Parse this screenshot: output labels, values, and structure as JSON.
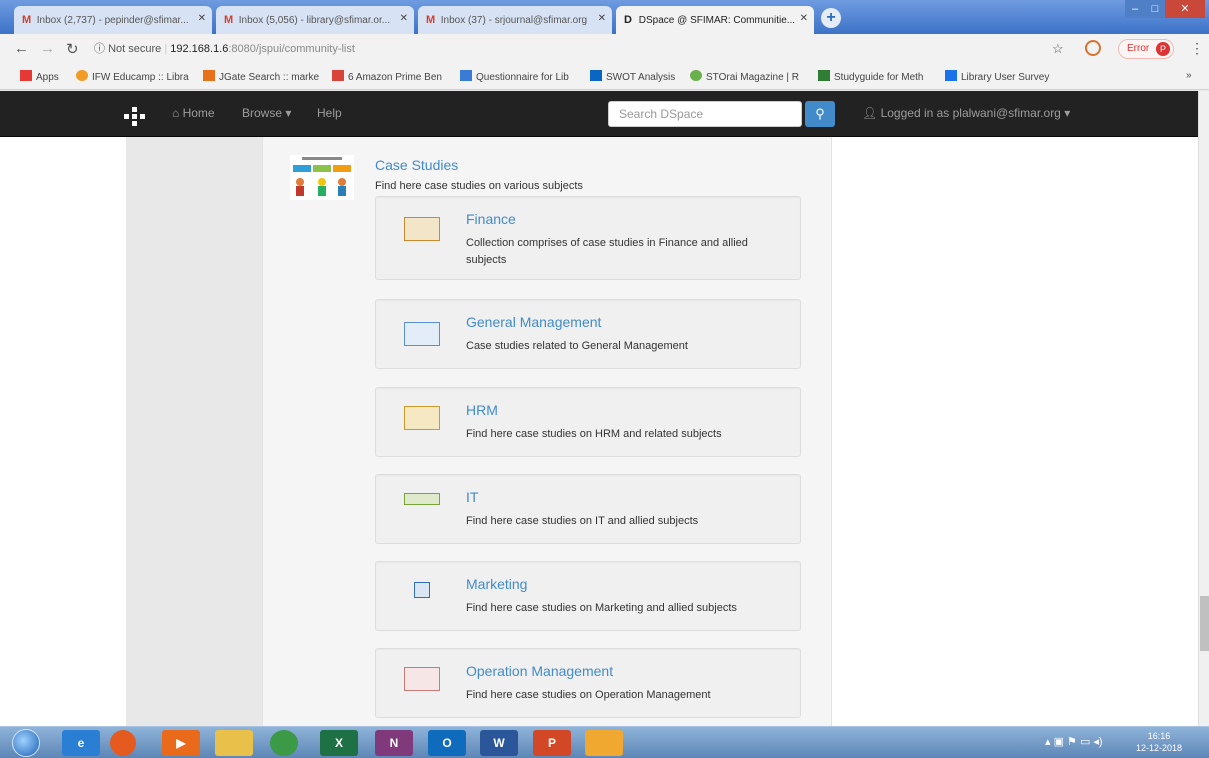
{
  "browser": {
    "tabs": [
      {
        "icon": "M",
        "label": "Inbox (2,737) - pepinder@sfimar...",
        "close": "✕"
      },
      {
        "icon": "M",
        "label": "Inbox (5,056) - library@sfimar.or...",
        "close": "✕"
      },
      {
        "icon": "M",
        "label": "Inbox (37) - srjournal@sfimar.org",
        "close": "✕"
      },
      {
        "icon": "D",
        "label": "DSpace @ SFIMAR: Communitie...",
        "close": "✕"
      }
    ],
    "new_tab": "+",
    "address": {
      "secure_label": "Not secure",
      "host": "192.168.1.6",
      "path": ":8080/jspui/community-list"
    },
    "error_label": "Error",
    "profile_initial": "P",
    "bookmarks": [
      {
        "label": "Apps",
        "color": "#e53935"
      },
      {
        "label": "IFW Educamp :: Libra",
        "color": "#f29b26"
      },
      {
        "label": "JGate Search :: marke",
        "color": "#e8711c"
      },
      {
        "label": "6 Amazon Prime Ben",
        "color": "#d9443a"
      },
      {
        "label": "Questionnaire for Lib",
        "color": "#3a7bd5"
      },
      {
        "label": "SWOT Analysis",
        "color": "#0a66c2"
      },
      {
        "label": "STOrai Magazine | R",
        "color": "#6ab04c"
      },
      {
        "label": "Studyguide for Meth",
        "color": "#2e7d32"
      },
      {
        "label": "Library User Survey",
        "color": "#1a73e8"
      }
    ],
    "bookmarks_overflow": "»"
  },
  "dspace_nav": {
    "home": "Home",
    "browse": "Browse ▾",
    "help": "Help",
    "search_placeholder": "Search DSpace",
    "logged_in": "Logged in as plalwani@sfimar.org ▾"
  },
  "parent_community": {
    "title": "Case Studies",
    "description": "Find here case studies on various subjects"
  },
  "subcommunities": [
    {
      "title": "Finance",
      "description": "Collection comprises of case studies in Finance and allied subjects",
      "thumb_color": "#c9892f"
    },
    {
      "title": "General Management",
      "description": "Case studies related to General Management",
      "thumb_color": "#5b8fd0"
    },
    {
      "title": "HRM",
      "description": "Find here case studies on HRM and related subjects",
      "thumb_color": "#c99a2a"
    },
    {
      "title": "IT",
      "description": "Find here case studies on IT and allied subjects",
      "thumb_color": "#7aa33a"
    },
    {
      "title": "Marketing",
      "description": "Find here case studies on Marketing and allied subjects",
      "thumb_color": "#2f6fb5"
    },
    {
      "title": "Operation Management",
      "description": "Find here case studies on Operation Management",
      "thumb_color": "#c97a7a"
    }
  ],
  "taskbar": {
    "apps": [
      {
        "label": "e",
        "color": "#2a7fd4"
      },
      {
        "label": "",
        "color": "#e55b1f"
      },
      {
        "label": "▶",
        "color": "#e86a1a"
      },
      {
        "label": "",
        "color": "#e9c14a"
      },
      {
        "label": "",
        "color": "#3c9a46"
      },
      {
        "label": "X",
        "color": "#1e7145"
      },
      {
        "label": "N",
        "color": "#80397b"
      },
      {
        "label": "O",
        "color": "#0f6cbd"
      },
      {
        "label": "W",
        "color": "#2b579a"
      },
      {
        "label": "P",
        "color": "#d24726"
      },
      {
        "label": "",
        "color": "#f0a830"
      }
    ],
    "time": "16:16",
    "date": "12-12-2018"
  }
}
